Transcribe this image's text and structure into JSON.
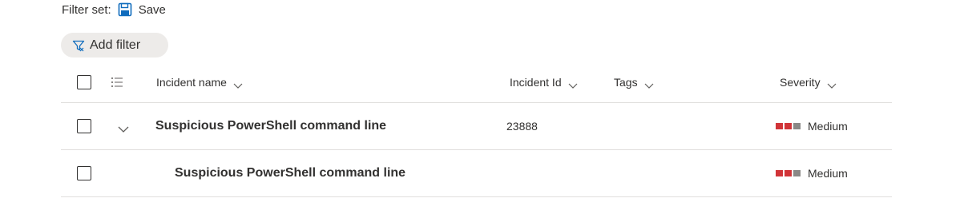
{
  "filter_set": {
    "label": "Filter set:",
    "save_label": "Save",
    "save_icon": "save-floppy-icon"
  },
  "add_filter": {
    "label": "Add filter",
    "icon": "filter-funnel-icon"
  },
  "table": {
    "columns": {
      "name": "Incident name",
      "id": "Incident Id",
      "tags": "Tags",
      "severity": "Severity"
    },
    "rows": [
      {
        "name": "Suspicious PowerShell command line",
        "id": "23888",
        "tags": "",
        "severity": "Medium",
        "expandable": true
      },
      {
        "name": "Suspicious PowerShell command line",
        "id": "",
        "tags": "",
        "severity": "Medium",
        "expandable": false
      }
    ]
  },
  "colors": {
    "severity_active": "#d13438",
    "severity_inactive": "#8a8886",
    "save_icon": "#0f6cbd",
    "filter_icon": "#0f6cbd",
    "pill_bg": "#edebe9",
    "row_border": "#e1dfdd"
  }
}
